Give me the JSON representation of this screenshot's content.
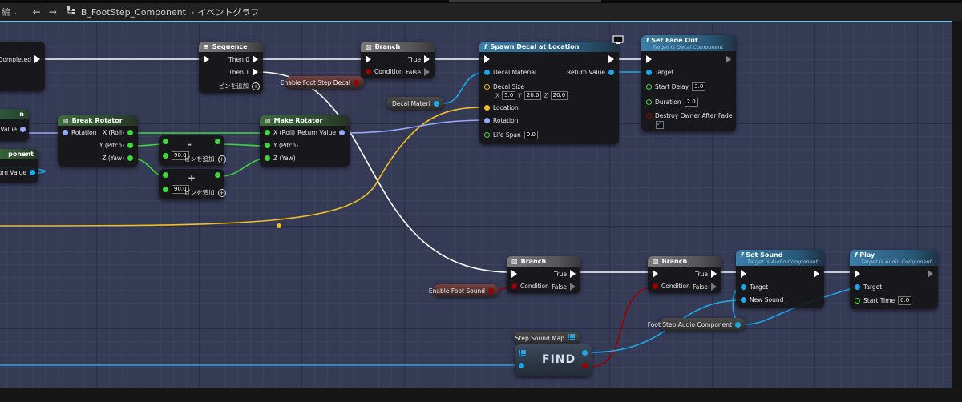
{
  "breadcrumb": {
    "left_label": "編",
    "blueprint_name": "B_FootStep_Component",
    "separator": "›",
    "graph_name": "イベントグラフ"
  },
  "colors": {
    "exec": "#ffffff",
    "object": "#1ea7e8",
    "bool": "#9b0000",
    "float": "#3ed83e",
    "vector": "#f2c020",
    "rotator": "#98a8f8"
  },
  "icons": [
    "back-arrow-icon",
    "forward-arrow-icon",
    "graph-hierarchy-icon",
    "function-icon",
    "branch-icon",
    "sequence-icon",
    "struct-icon",
    "map-icon",
    "monitor-icon",
    "checkbox-check-icon"
  ],
  "edge_nodes": {
    "completed": "Completed",
    "left_n": "n",
    "left_return_value": "n Value",
    "left_component": "ponent",
    "left_return_value2": "Return Value"
  },
  "sequence": {
    "title": "Sequence",
    "then0": "Then 0",
    "then1": "Then 1",
    "add_pin": "ピンを追加"
  },
  "branch1": {
    "title": "Branch",
    "condition": "Condition",
    "true_label": "True",
    "false_label": "False"
  },
  "enable_foot_step_decal": "Enable Foot Step Decal",
  "spawn_decal": {
    "title": "Spawn Decal at Location",
    "decal_material": "Decal Material",
    "return_value": "Return Value",
    "decal_size": "Decal Size",
    "x_label": "X",
    "x_value": "5.0",
    "y_label": "Y",
    "y_value": "20.0",
    "z_label": "Z",
    "z_value": "20.0",
    "location": "Location",
    "rotation": "Rotation",
    "life_span": "Life Span",
    "life_span_value": "0.0"
  },
  "decal_material_var": "Decal Material",
  "set_fade_out": {
    "title": "Set Fade Out",
    "subtitle": "Target is Decal Component",
    "target": "Target",
    "start_delay": "Start Delay",
    "start_delay_value": "3.0",
    "duration": "Duration",
    "duration_value": "2.0",
    "destroy_owner": "Destroy Owner After Fade"
  },
  "break_rotator": {
    "title": "Break Rotator",
    "rotation": "Rotation",
    "x_roll": "X (Roll)",
    "y_pitch": "Y (Pitch)",
    "z_yaw": "Z (Yaw)"
  },
  "make_rotator": {
    "title": "Make Rotator",
    "x_roll": "X (Roll)",
    "y_pitch": "Y (Pitch)",
    "z_yaw": "Z (Yaw)",
    "return_value": "Return Value"
  },
  "subtract_node": {
    "operator": "-",
    "value": "90.0",
    "add_pin": "ピンを追加"
  },
  "add_node": {
    "operator": "+",
    "value": "90.0",
    "add_pin": "ピンを追加"
  },
  "branch2": {
    "title": "Branch",
    "condition": "Condition",
    "true_label": "True",
    "false_label": "False"
  },
  "enable_foot_sound": "Enable Foot Sound",
  "branch3": {
    "title": "Branch",
    "condition": "Condition",
    "true_label": "True",
    "false_label": "False"
  },
  "set_sound": {
    "title": "Set Sound",
    "subtitle": "Target is Audio Component",
    "target": "Target",
    "new_sound": "New Sound"
  },
  "play": {
    "title": "Play",
    "subtitle": "Target is Audio Component",
    "target": "Target",
    "start_time": "Start Time",
    "start_time_value": "0.0"
  },
  "foot_step_audio_component": "Foot Step Audio Component",
  "step_sound_map": "Step Sound Map",
  "find_node": {
    "title": "FIND"
  }
}
